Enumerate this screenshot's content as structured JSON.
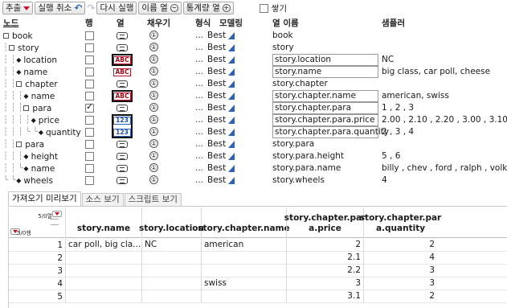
{
  "toolbar": {
    "extract_label": "추출",
    "undo_label": "실행 취소",
    "redo_label": "다시 실행",
    "remove_col_label": "이름 열",
    "stats_col_label": "통계량 열",
    "stack_label": "쌓기",
    "stack_checked": false
  },
  "header": {
    "node": "노드",
    "row": "행",
    "col": "열",
    "fill": "채우기",
    "format": "형식",
    "modeling": "모델링",
    "colname": "열 이름",
    "sampler": "샘플러"
  },
  "tree_rows": [
    {
      "guide": "",
      "kind": "node",
      "label": "book",
      "checked": false,
      "icon": "list",
      "fill": "①",
      "fmt": "...",
      "best": "Best",
      "colname": "book",
      "boxed": false,
      "sample": ""
    },
    {
      "guide": "┆",
      "kind": "node",
      "label": "story",
      "checked": false,
      "icon": "list",
      "fill": "①",
      "fmt": "...",
      "best": "Best",
      "colname": "story",
      "boxed": false,
      "sample": ""
    },
    {
      "guide": "┆ ┆",
      "kind": "leaf",
      "label": "location",
      "checked": false,
      "icon": "abc",
      "fill": "①",
      "fmt": "...",
      "best": "Best",
      "colname": "story.location",
      "boxed": true,
      "sample": "NC"
    },
    {
      "guide": "┆ ┆",
      "kind": "leaf",
      "label": "name",
      "checked": false,
      "icon": "abc",
      "fill": "①",
      "fmt": "...",
      "best": "Best",
      "colname": "story.name",
      "boxed": true,
      "sample": "big class, car poll, cheese"
    },
    {
      "guide": "┆ ┆",
      "kind": "node",
      "label": "chapter",
      "checked": false,
      "icon": "list",
      "fill": "①",
      "fmt": "...",
      "best": "Best",
      "colname": "story.chapter",
      "boxed": false,
      "sample": ""
    },
    {
      "guide": "┆ ┆ ┆",
      "kind": "leaf",
      "label": "name",
      "checked": false,
      "icon": "abc",
      "fill": "①",
      "fmt": "...",
      "best": "Best",
      "colname": "story.chapter.name",
      "boxed": true,
      "sample": "american, swiss"
    },
    {
      "guide": "┆ ┆ ┆",
      "kind": "node",
      "label": "para",
      "checked": true,
      "icon": "list",
      "fill": "①",
      "fmt": "...",
      "best": "Best",
      "colname": "story.chapter.para",
      "boxed": true,
      "sample": "1 , 2 , 3"
    },
    {
      "guide": "┆ ┆ ┆ ┆",
      "kind": "leaf",
      "label": "price",
      "checked": false,
      "icon": "123",
      "fill": "①",
      "fmt": "...",
      "best": "Best",
      "colname": "story.chapter.para.price",
      "boxed": true,
      "sample": "2.00 , 2.10 , 2.20 , 3.00 , 3.10"
    },
    {
      "guide": "┆ ┆ ┆ ╰ ╰",
      "kind": "leaf",
      "label": "quantity",
      "checked": false,
      "icon": "123",
      "fill": "①",
      "fmt": "...",
      "best": "Best",
      "colname": "story.chapter.para.quantity",
      "boxed": true,
      "sample": "2 , 3 , 4"
    },
    {
      "guide": "┆ ┆",
      "kind": "node",
      "label": "para",
      "checked": false,
      "icon": "list",
      "fill": "①",
      "fmt": "...",
      "best": "Best",
      "colname": "story.para",
      "boxed": false,
      "sample": ""
    },
    {
      "guide": "┆ ┆ ┆",
      "kind": "leaf",
      "label": "height",
      "checked": false,
      "icon": "list",
      "fill": "①",
      "fmt": "...",
      "best": "Best",
      "colname": "story.para.height",
      "boxed": false,
      "sample": "5 , 6"
    },
    {
      "guide": "┆ ┆ ╰",
      "kind": "leaf",
      "label": "name",
      "checked": false,
      "icon": "list",
      "fill": "①",
      "fmt": "...",
      "best": "Best",
      "colname": "story.para.name",
      "boxed": false,
      "sample": "billy , chev , ford , ralph , volk"
    },
    {
      "guide": "╰ ╰",
      "kind": "leaf",
      "label": "wheels",
      "checked": false,
      "icon": "list",
      "fill": "①",
      "fmt": "...",
      "best": "Best",
      "colname": "story.wheels",
      "boxed": false,
      "sample": "4"
    }
  ],
  "tabs": [
    "가져오기 미리보기",
    "소스 보기",
    "스크립트 보기"
  ],
  "preview": {
    "cols_label": "5/0열",
    "rows_label": "5/0행",
    "columns": [
      "story.name",
      "story.location",
      "story.chapter.name",
      "story.chapter.par a.price",
      "story.chapter.par a.quantity"
    ],
    "rows": [
      [
        "1",
        "car poll, big cla...",
        "NC",
        "american",
        "2",
        "2"
      ],
      [
        "2",
        "",
        "",
        "",
        "2.1",
        "4"
      ],
      [
        "3",
        "",
        "",
        "",
        "2.2",
        "3"
      ],
      [
        "4",
        "",
        "",
        "swiss",
        "3",
        "3"
      ],
      [
        "5",
        "",
        "",
        "",
        "3.1",
        "2"
      ]
    ]
  },
  "colors": {
    "accent_red": "#c8102e",
    "accent_blue": "#2a63b8"
  }
}
